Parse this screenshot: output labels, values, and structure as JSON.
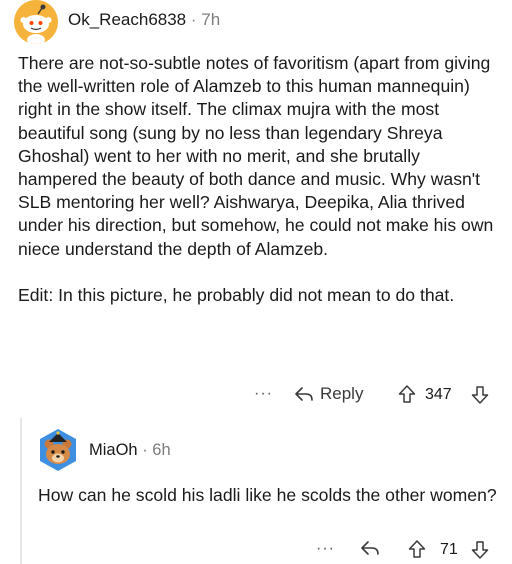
{
  "top_comment": {
    "username": "Ok_Reach6838",
    "separator": "·",
    "time": "7h",
    "paragraph_1": "There are not-so-subtle notes of favoritism (apart from giving the well-written role of Alamzeb to this human mannequin) right in the show itself. The climax mujra with the most beautiful song (sung by no less than legendary Shreya Ghoshal) went to her with no merit, and she brutally hampered the beauty of both dance and music. Why wasn't SLB mentoring her well? Aishwarya, Deepika, Alia thrived under his direction, but somehow, he could not make his own niece understand the depth of Alamzeb.",
    "paragraph_2": "Edit: In this picture, he probably did not mean to do that.",
    "more": "···",
    "reply_label": "Reply",
    "vote_count": "347"
  },
  "reply_comment": {
    "username": "MiaOh",
    "separator": "·",
    "time": "6h",
    "body": "How can he scold his ladli like he scolds the other women?",
    "more": "···",
    "vote_count": "71"
  },
  "colors": {
    "avatar_top_bg": "#f5b33b",
    "avatar_reply_bg": "#3f8fe0",
    "text": "#1a1a1b",
    "meta": "#7c7c7c"
  },
  "icons": {
    "avatar_top": "snoo-avatar-icon",
    "avatar_reply": "snoo-bear-avatar-icon",
    "reply": "reply-arrow-icon",
    "upvote": "upvote-arrow-icon",
    "downvote": "downvote-arrow-icon",
    "more": "more-options-icon"
  }
}
